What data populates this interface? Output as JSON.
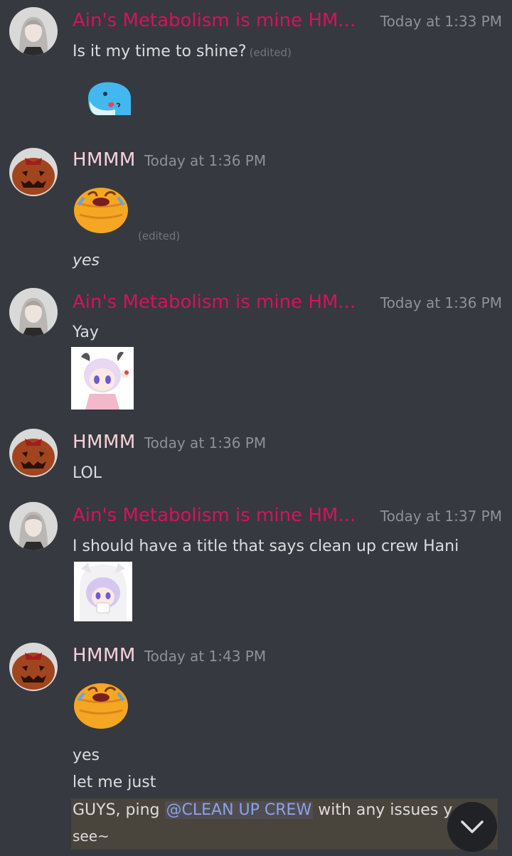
{
  "messages": [
    {
      "author": "Ain's Metabolism is mine HM...",
      "timestamp": "Today at 1:33 PM",
      "lines": [
        {
          "text": "Is it my time to shine?",
          "edited": "(edited)"
        }
      ],
      "avatar": "girl-avatar",
      "emoji": "blue-whale-emoji"
    },
    {
      "author": "HMMM",
      "timestamp": "Today at 1:36 PM",
      "avatar": "pumpkin-avatar",
      "emoji": "laughing-blob-emoji",
      "edited": "(edited)",
      "lines": [
        {
          "text": "yes"
        }
      ]
    },
    {
      "author": "Ain's Metabolism is mine HM...",
      "timestamp": "Today at 1:36 PM",
      "avatar": "girl-avatar",
      "lines": [
        {
          "text": "Yay"
        }
      ],
      "emoji": "anime-girl-wave-emoji"
    },
    {
      "author": "HMMM",
      "timestamp": "Today at 1:36 PM",
      "avatar": "pumpkin-avatar",
      "lines": [
        {
          "text": "LOL"
        }
      ]
    },
    {
      "author": "Ain's Metabolism is mine HM...",
      "timestamp": "Today at 1:37 PM",
      "avatar": "girl-avatar",
      "lines": [
        {
          "text": "I should have a title that says clean up crew Hani"
        }
      ],
      "emoji": "anime-girl-hood-emoji"
    },
    {
      "author": "HMMM",
      "timestamp": "Today at 1:43 PM",
      "avatar": "pumpkin-avatar",
      "emoji": "laughing-blob-emoji",
      "lines": [
        {
          "text": "yes"
        },
        {
          "text": "let me just"
        },
        {
          "prefix": "GUYS, ping ",
          "mention": "@CLEAN UP CREW",
          "suffix": " with any issues y"
        },
        {
          "text": "see~"
        }
      ]
    }
  ],
  "colors": {
    "background": "#36393f",
    "username_pink": "#d4145a",
    "username_light": "#f6d2db",
    "timestamp": "#8e9297",
    "mention": "#8ea1e1",
    "highlight": "#49443c"
  },
  "scroll_button": {
    "icon": "chevron-down-icon"
  }
}
